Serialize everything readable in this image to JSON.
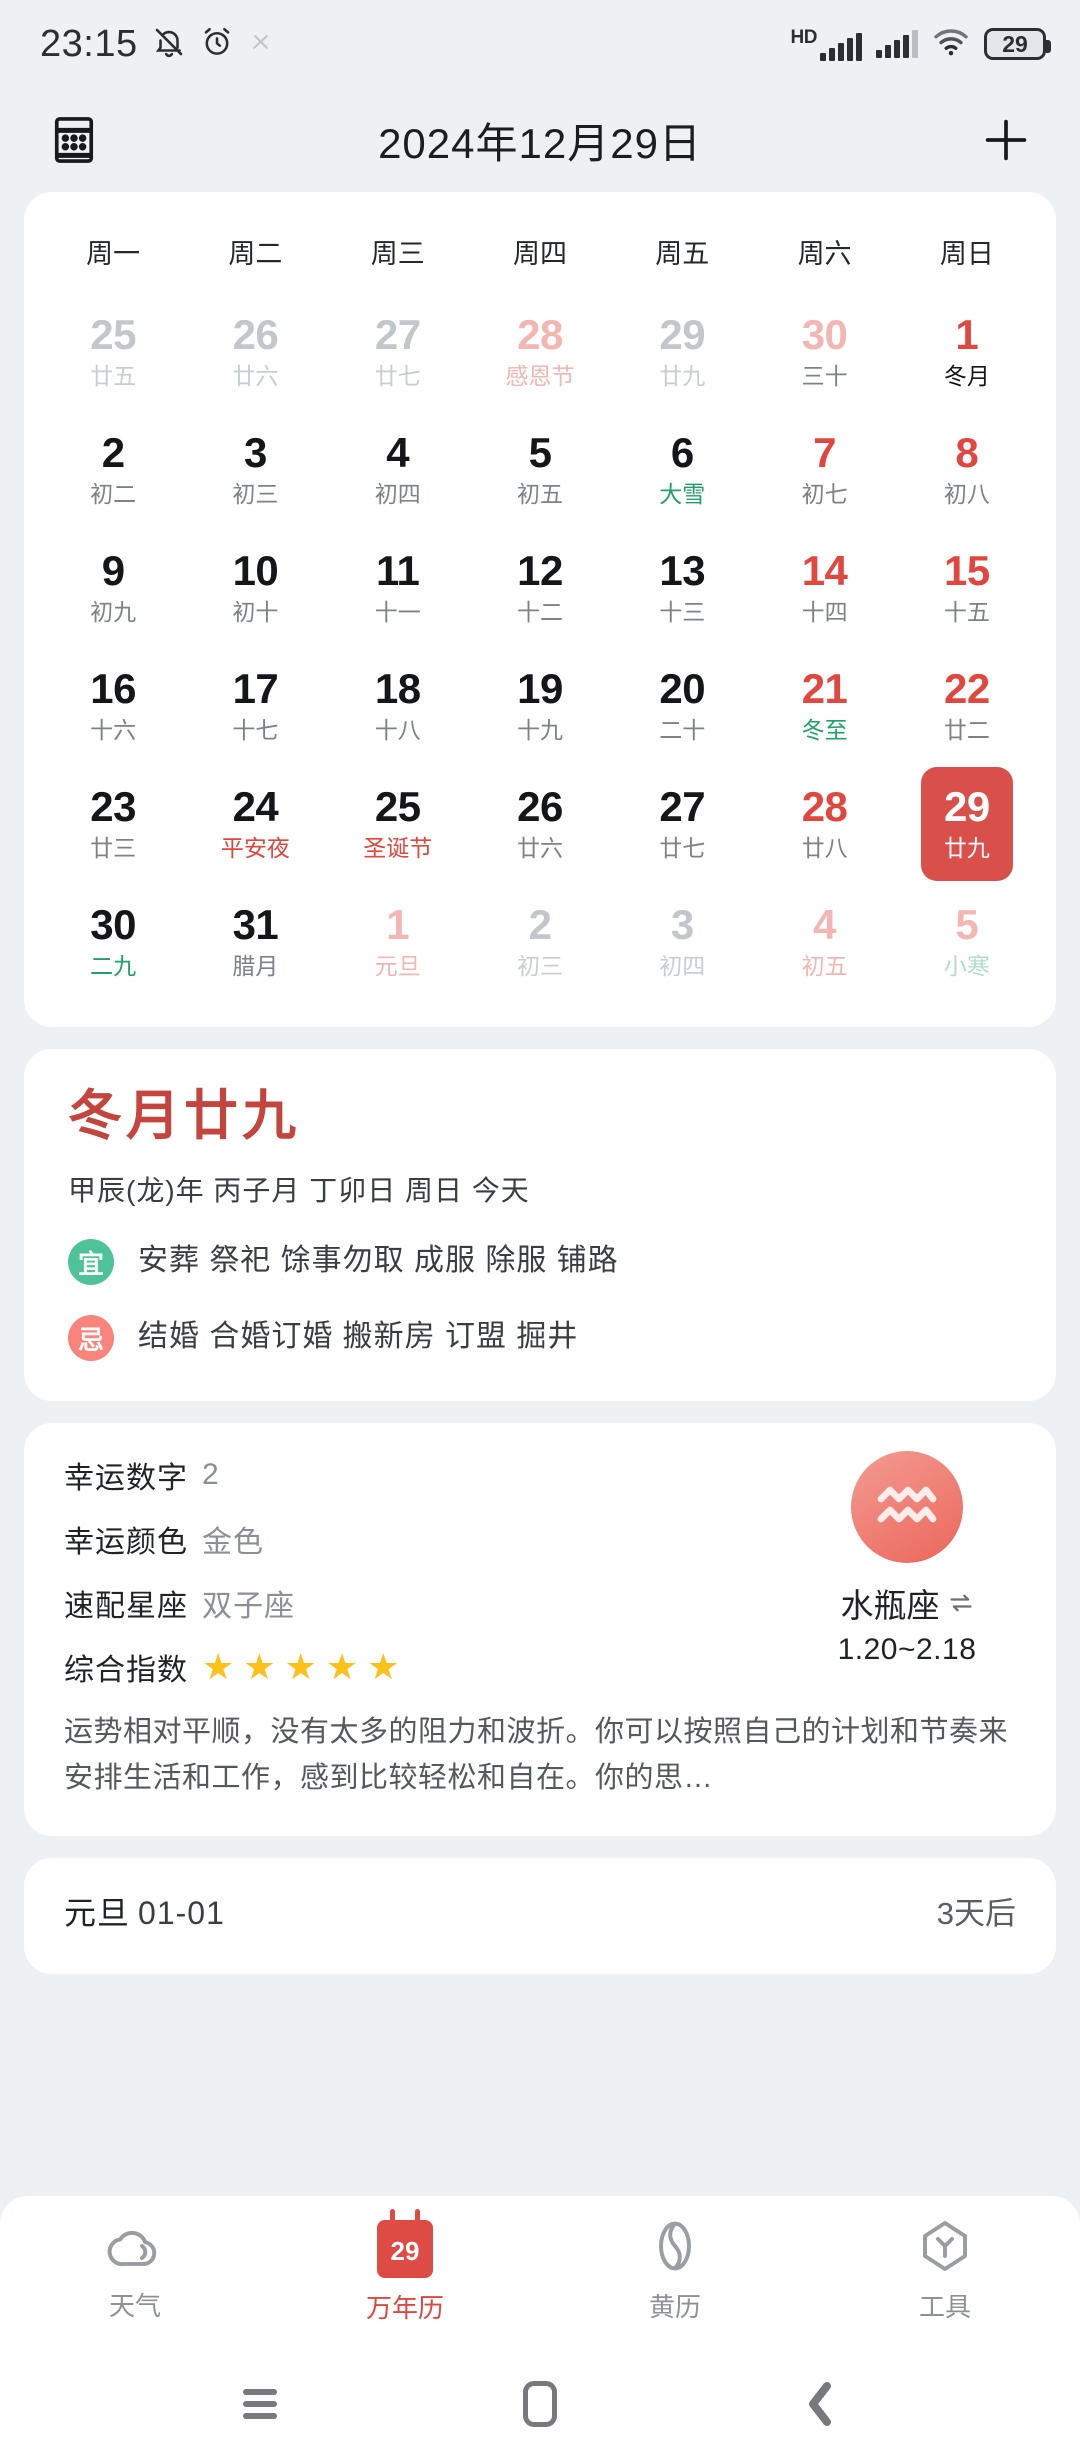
{
  "status_bar": {
    "time": "23:15",
    "icons_left": [
      "mute-bell-icon",
      "alarm-clock-icon",
      "faint-icon"
    ],
    "network_label": "HD",
    "battery_percent": "29",
    "icons_right": [
      "hd-signal-icon",
      "signal-icon",
      "wifi-icon",
      "battery-icon"
    ]
  },
  "app_bar": {
    "menu_icon": "calendar-grid-icon",
    "title": "2024年12月29日",
    "add_icon": "plus-icon"
  },
  "calendar": {
    "weekdays": [
      "周一",
      "周二",
      "周三",
      "周四",
      "周五",
      "周六",
      "周日"
    ],
    "weeks": [
      [
        {
          "sol": "25",
          "lun": "廿五",
          "style": "other"
        },
        {
          "sol": "26",
          "lun": "廿六",
          "style": "other"
        },
        {
          "sol": "27",
          "lun": "廿七",
          "style": "other"
        },
        {
          "sol": "28",
          "lun": "感恩节",
          "style": "other red lun-red"
        },
        {
          "sol": "29",
          "lun": "廿九",
          "style": "other"
        },
        {
          "sol": "30",
          "lun": "三十",
          "style": "other red"
        },
        {
          "sol": "1",
          "lun": "冬月",
          "style": "red black-lun"
        }
      ],
      [
        {
          "sol": "2",
          "lun": "初二",
          "style": ""
        },
        {
          "sol": "3",
          "lun": "初三",
          "style": ""
        },
        {
          "sol": "4",
          "lun": "初四",
          "style": ""
        },
        {
          "sol": "5",
          "lun": "初五",
          "style": ""
        },
        {
          "sol": "6",
          "lun": "大雪",
          "style": "lun-green"
        },
        {
          "sol": "7",
          "lun": "初七",
          "style": "red"
        },
        {
          "sol": "8",
          "lun": "初八",
          "style": "red"
        }
      ],
      [
        {
          "sol": "9",
          "lun": "初九",
          "style": ""
        },
        {
          "sol": "10",
          "lun": "初十",
          "style": ""
        },
        {
          "sol": "11",
          "lun": "十一",
          "style": ""
        },
        {
          "sol": "12",
          "lun": "十二",
          "style": ""
        },
        {
          "sol": "13",
          "lun": "十三",
          "style": ""
        },
        {
          "sol": "14",
          "lun": "十四",
          "style": "red"
        },
        {
          "sol": "15",
          "lun": "十五",
          "style": "red"
        }
      ],
      [
        {
          "sol": "16",
          "lun": "十六",
          "style": ""
        },
        {
          "sol": "17",
          "lun": "十七",
          "style": ""
        },
        {
          "sol": "18",
          "lun": "十八",
          "style": ""
        },
        {
          "sol": "19",
          "lun": "十九",
          "style": ""
        },
        {
          "sol": "20",
          "lun": "二十",
          "style": ""
        },
        {
          "sol": "21",
          "lun": "冬至",
          "style": "red lun-green"
        },
        {
          "sol": "22",
          "lun": "廿二",
          "style": "red"
        }
      ],
      [
        {
          "sol": "23",
          "lun": "廿三",
          "style": ""
        },
        {
          "sol": "24",
          "lun": "平安夜",
          "style": "lun-red"
        },
        {
          "sol": "25",
          "lun": "圣诞节",
          "style": "lun-red"
        },
        {
          "sol": "26",
          "lun": "廿六",
          "style": ""
        },
        {
          "sol": "27",
          "lun": "廿七",
          "style": ""
        },
        {
          "sol": "28",
          "lun": "廿八",
          "style": "red"
        },
        {
          "sol": "29",
          "lun": "廿九",
          "style": "sel"
        }
      ],
      [
        {
          "sol": "30",
          "lun": "二九",
          "style": "lun-green"
        },
        {
          "sol": "31",
          "lun": "腊月",
          "style": ""
        },
        {
          "sol": "1",
          "lun": "元旦",
          "style": "other red lun-red"
        },
        {
          "sol": "2",
          "lun": "初三",
          "style": "other"
        },
        {
          "sol": "3",
          "lun": "初四",
          "style": "other"
        },
        {
          "sol": "4",
          "lun": "初五",
          "style": "other red lun-red"
        },
        {
          "sol": "5",
          "lun": "小寒",
          "style": "other red lun-green"
        }
      ]
    ]
  },
  "lunar_detail": {
    "title": "冬月廿九",
    "subtitle": "甲辰(龙)年 丙子月 丁卯日 周日  今天",
    "yi_badge": "宜",
    "yi_text": "安葬 祭祀 馀事勿取 成服 除服 铺路",
    "ji_badge": "忌",
    "ji_text": "结婚 合婚订婚 搬新房 订盟 掘井"
  },
  "fortune": {
    "lucky_number_label": "幸运数字",
    "lucky_number_value": "2",
    "lucky_color_label": "幸运颜色",
    "lucky_color_value": "金色",
    "match_sign_label": "速配星座",
    "match_sign_value": "双子座",
    "index_label": "综合指数",
    "star_count": 5,
    "description": "运势相对平顺，没有太多的阻力和波折。你可以按照自己的计划和节奏来安排生活和工作，感到比较轻松和自在。你的思…",
    "zodiac": {
      "icon": "aquarius-icon",
      "name": "水瓶座",
      "swap_icon": "swap-arrows-icon",
      "date_range": "1.20~2.18"
    }
  },
  "holiday": {
    "name": "元旦",
    "date": "01-01",
    "countdown": "3天后"
  },
  "bottom_nav": [
    {
      "icon": "cloud-icon",
      "label": "天气",
      "active": false
    },
    {
      "icon": "calendar-29-icon",
      "label": "万年历",
      "active": true,
      "badge": "29"
    },
    {
      "icon": "huangli-icon",
      "label": "黄历",
      "active": false
    },
    {
      "icon": "tools-icon",
      "label": "工具",
      "active": false
    }
  ],
  "android_nav": {
    "recents_icon": "recents-lines-icon",
    "home_icon": "home-square-icon",
    "back_icon": "back-chevron-icon"
  },
  "colors": {
    "accent_red": "#e0483f",
    "selected_red": "#d94f4a",
    "green": "#23a06a",
    "star_yellow": "#fcc21b",
    "page_bg": "#eef1f4"
  }
}
